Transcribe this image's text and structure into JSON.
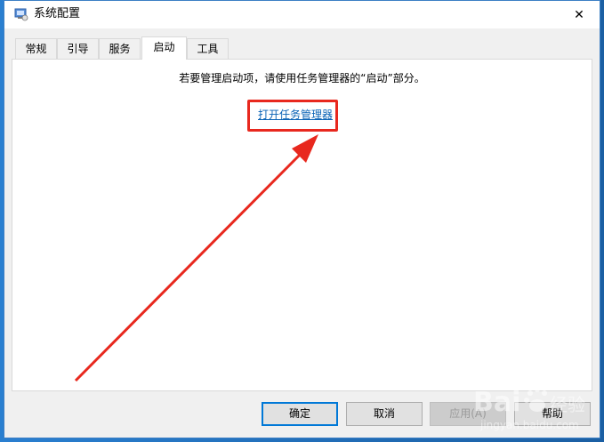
{
  "window": {
    "title": "系统配置",
    "close_glyph": "✕"
  },
  "tabs": [
    {
      "label": "常规",
      "active": false
    },
    {
      "label": "引导",
      "active": false
    },
    {
      "label": "服务",
      "active": false
    },
    {
      "label": "启动",
      "active": true
    },
    {
      "label": "工具",
      "active": false
    }
  ],
  "startup_panel": {
    "instruction": "若要管理启动项，请使用任务管理器的“启动”部分。",
    "link_label": "打开任务管理器"
  },
  "buttons": {
    "ok": "确定",
    "cancel": "取消",
    "apply": "应用(A)",
    "help": "帮助"
  },
  "annotation": {
    "color": "#e8281e"
  },
  "watermark": {
    "brand": "Bai",
    "brand_suffix": "经验",
    "url": "jingyan.baidu.com"
  },
  "colors": {
    "accent": "#0078d7",
    "link": "#0b63b6"
  }
}
